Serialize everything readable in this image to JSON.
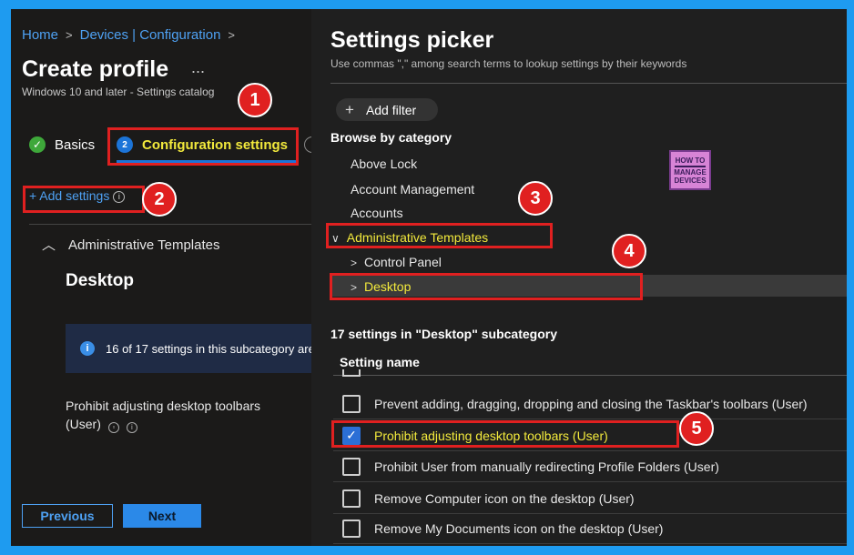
{
  "breadcrumb": [
    "Home",
    "Devices | Configuration"
  ],
  "page": {
    "title": "Create profile",
    "more": "...",
    "subtitle": "Windows 10 and later - Settings catalog"
  },
  "steps": [
    {
      "label": "Basics",
      "state": "done"
    },
    {
      "label": "Configuration settings",
      "number": "2",
      "state": "active"
    }
  ],
  "add_settings": "+ Add settings",
  "left_panel": {
    "group": "Administrative Templates",
    "subcategory": "Desktop",
    "info": "16 of 17 settings in this subcategory are",
    "setting_line1": "Prohibit adjusting desktop toolbars",
    "setting_line2": "(User)"
  },
  "buttons": {
    "previous": "Previous",
    "next": "Next"
  },
  "picker": {
    "title": "Settings picker",
    "help": "Use commas \",\" among search terms to lookup settings by their keywords",
    "add_filter": "Add filter",
    "browse": "Browse by category",
    "categories": [
      "Above Lock",
      "Account Management",
      "Accounts"
    ],
    "expanded_category": "Administrative Templates",
    "subcategories": [
      "Control Panel",
      "Desktop"
    ],
    "count_heading": "17 settings in \"Desktop\" subcategory",
    "column": "Setting name",
    "settings": [
      {
        "label": "Prevent adding, dragging, dropping and closing the Taskbar's toolbars (User)",
        "checked": false
      },
      {
        "label": "Prohibit adjusting desktop toolbars (User)",
        "checked": true
      },
      {
        "label": "Prohibit User from manually redirecting Profile Folders (User)",
        "checked": false
      },
      {
        "label": "Remove Computer icon on the desktop (User)",
        "checked": false
      },
      {
        "label": "Remove My Documents icon on the desktop (User)",
        "checked": false
      }
    ]
  },
  "annotations": [
    "1",
    "2",
    "3",
    "4",
    "5"
  ],
  "logo": {
    "line1": "HOW TO",
    "line2": "MANAGE",
    "line3": "DEVICES"
  },
  "colors": {
    "accent": "#2b89e8",
    "highlight_text": "#f3ea3c",
    "annotation": "#e02020",
    "frame": "#1e9bf0"
  }
}
